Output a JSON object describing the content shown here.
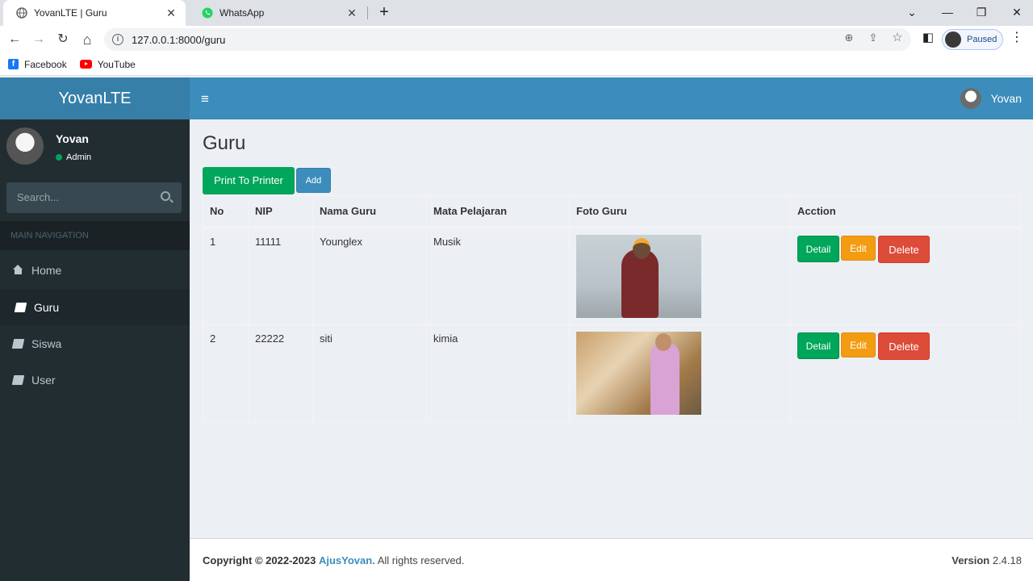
{
  "browser": {
    "tabs": [
      {
        "title": "YovanLTE | Guru",
        "close": "✕"
      },
      {
        "title": "WhatsApp",
        "close": "✕"
      }
    ],
    "new_tab": "+",
    "window_controls": {
      "minimize": "—",
      "restore": "❐",
      "close": "✕"
    },
    "nav": {
      "back": "←",
      "forward": "→",
      "reload": "↻",
      "home": "⌂"
    },
    "url": "127.0.0.1:8000/guru",
    "profile_status": "Paused",
    "menu": "⋮",
    "bookmarks": [
      {
        "label": "Facebook",
        "icon": "facebook-icon"
      },
      {
        "label": "YouTube",
        "icon": "youtube-icon"
      }
    ]
  },
  "app": {
    "logo": "YovanLTE",
    "hamburger": "≡",
    "nav_user": "Yovan"
  },
  "sidebar": {
    "user": {
      "name": "Yovan",
      "role": "Admin"
    },
    "search_placeholder": "Search...",
    "header": "MAIN NAVIGATION",
    "items": [
      {
        "label": "Home",
        "icon": "home-icon",
        "active": false
      },
      {
        "label": "Guru",
        "icon": "book-icon",
        "active": true
      },
      {
        "label": "Siswa",
        "icon": "book-icon",
        "active": false
      },
      {
        "label": "User",
        "icon": "book-icon",
        "active": false
      }
    ]
  },
  "main": {
    "title": "Guru",
    "print_button": "Print To Printer",
    "add_button": "Add",
    "columns": [
      "No",
      "NIP",
      "Nama Guru",
      "Mata Pelajaran",
      "Foto Guru",
      "Acction"
    ],
    "rows": [
      {
        "no": "1",
        "nip": "11111",
        "nama": "Younglex",
        "mapel": "Musik"
      },
      {
        "no": "2",
        "nip": "22222",
        "nama": "siti",
        "mapel": "kimia"
      }
    ],
    "actions": {
      "detail": "Detail",
      "edit": "Edit",
      "delete": "Delete"
    }
  },
  "footer": {
    "copyright": "Copyright © 2022-2023",
    "brand": "AjusYovan.",
    "rights": "All rights reserved.",
    "version_label": "Version",
    "version": "2.4.18"
  },
  "colors": {
    "navbar": "#3c8dbc",
    "logo_bg": "#367fa9",
    "sidebar": "#222d32",
    "success": "#00a65a",
    "warning": "#f39c12",
    "danger": "#dd4b39"
  }
}
